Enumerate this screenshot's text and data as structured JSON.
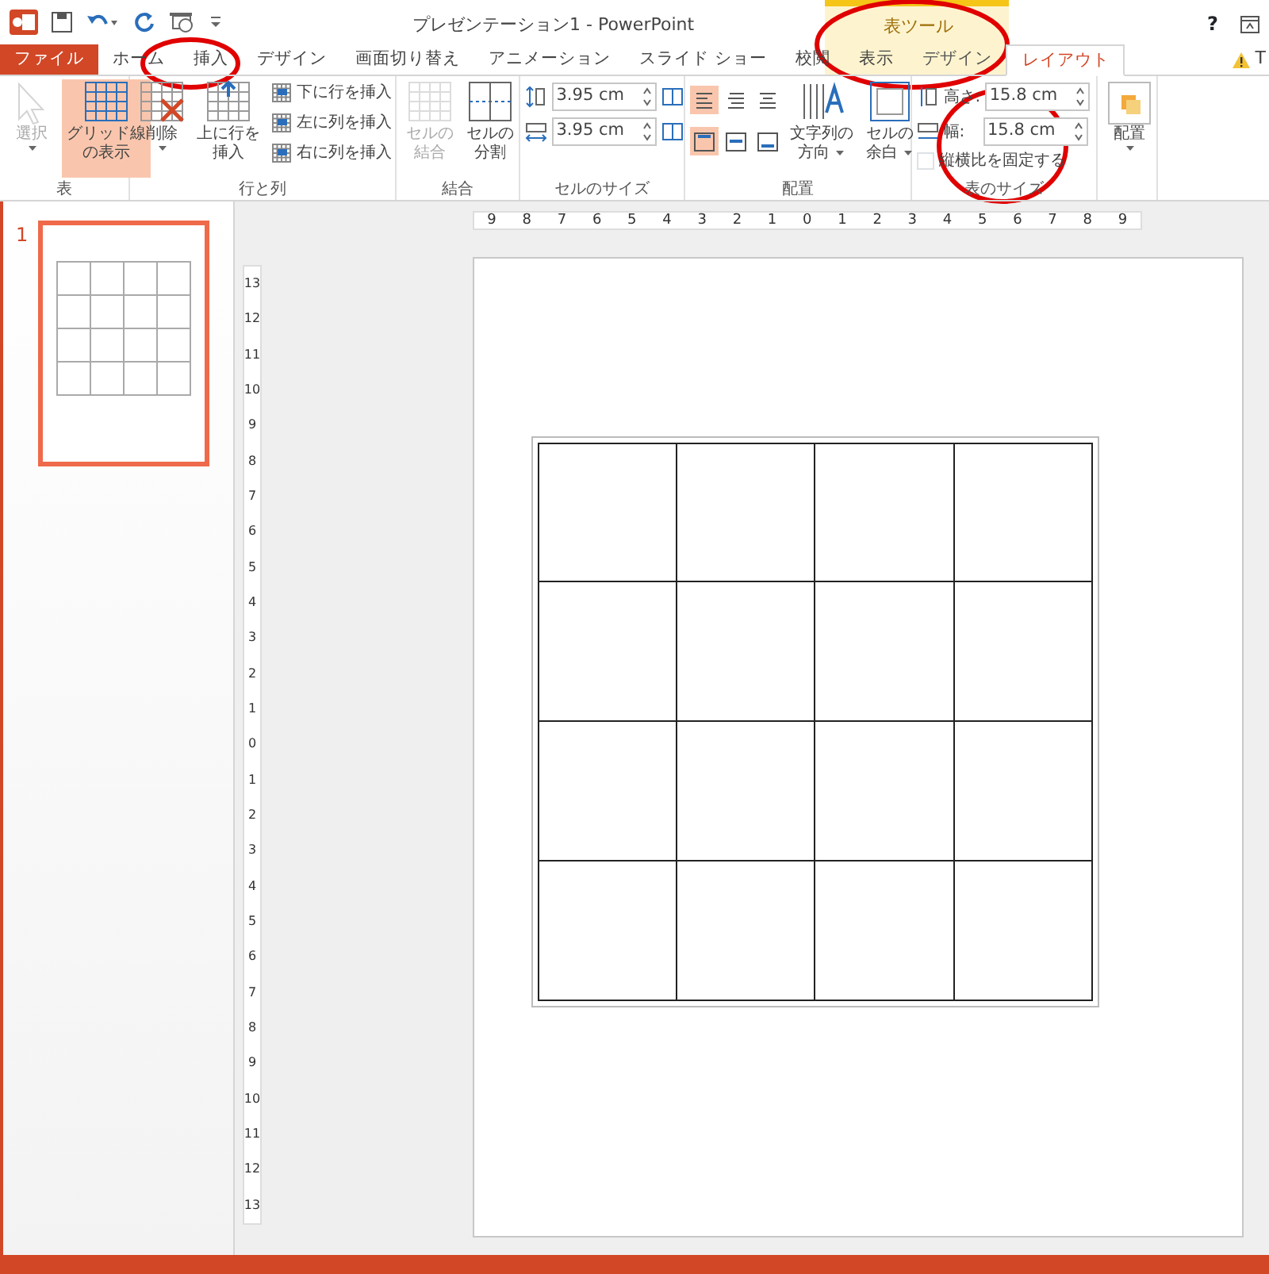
{
  "title_bar": {
    "title": "プレゼンテーション1 - PowerPoint",
    "context_label": "表ツール",
    "help": "?"
  },
  "tabs": [
    {
      "label": "ファイル",
      "kind": "file",
      "selected": false
    },
    {
      "label": "ホーム",
      "kind": "normal",
      "selected": false
    },
    {
      "label": "挿入",
      "kind": "normal",
      "selected": false
    },
    {
      "label": "デザイン",
      "kind": "normal",
      "selected": false
    },
    {
      "label": "画面切り替え",
      "kind": "normal",
      "selected": false
    },
    {
      "label": "アニメーション",
      "kind": "normal",
      "selected": false
    },
    {
      "label": "スライド ショー",
      "kind": "normal",
      "selected": false
    },
    {
      "label": "校閲",
      "kind": "normal",
      "selected": false
    },
    {
      "label": "表示",
      "kind": "normal",
      "selected": false
    },
    {
      "label": "デザイン",
      "kind": "context",
      "selected": false
    },
    {
      "label": "レイアウト",
      "kind": "context",
      "selected": true
    }
  ],
  "account": "T",
  "ribbon": [
    {
      "label": "表",
      "items": [
        {
          "kind": "large",
          "lines": [
            "選択"
          ],
          "disabled": true,
          "dropdown": true,
          "active": false
        },
        {
          "kind": "large",
          "lines": [
            "グリッド線",
            "の表示"
          ],
          "disabled": false,
          "dropdown": false,
          "active": true
        }
      ]
    },
    {
      "label": "行と列",
      "items": [
        {
          "kind": "large",
          "lines": [
            "削除"
          ],
          "disabled": false,
          "dropdown": true,
          "active": false
        },
        {
          "kind": "large",
          "lines": [
            "上に行を",
            "挿入"
          ],
          "disabled": false,
          "dropdown": false,
          "active": false
        },
        {
          "kind": "smalls",
          "entries": [
            "下に行を挿入",
            "左に列を挿入",
            "右に列を挿入"
          ]
        }
      ]
    },
    {
      "label": "結合",
      "items": [
        {
          "kind": "large",
          "lines": [
            "セルの",
            "結合"
          ],
          "disabled": true,
          "dropdown": false,
          "active": false
        },
        {
          "kind": "large",
          "lines": [
            "セルの",
            "分割"
          ],
          "disabled": false,
          "dropdown": false,
          "active": false
        }
      ]
    },
    {
      "label": "セルのサイズ",
      "items": [
        {
          "kind": "spins",
          "fields": [
            {
              "value": "3.95 cm"
            },
            {
              "value": "3.95 cm"
            }
          ]
        }
      ]
    },
    {
      "label": "配置",
      "items": [
        {
          "kind": "aligns",
          "cells": [
            {
              "selected": true
            },
            {
              "selected": false
            },
            {
              "selected": false
            },
            {
              "selected": true
            },
            {
              "selected": false
            },
            {
              "selected": false
            }
          ]
        },
        {
          "kind": "large",
          "lines": [
            "文字列の",
            "方向"
          ],
          "disabled": false,
          "dropdown": true,
          "active": false
        },
        {
          "kind": "large",
          "lines": [
            "セルの",
            "余白"
          ],
          "disabled": false,
          "dropdown": true,
          "active": false
        }
      ]
    },
    {
      "label": "表のサイズ",
      "items": [
        {
          "kind": "sizefields",
          "fields": [
            {
              "label": "高さ:",
              "value": "15.8 cm"
            },
            {
              "label": "幅:",
              "value": "15.8 cm"
            }
          ],
          "checkbox": {
            "label": "縦横比を固定する",
            "checked": false
          }
        }
      ]
    },
    {
      "items": [
        {
          "kind": "large",
          "lines": [
            "配置"
          ],
          "disabled": false,
          "dropdown": true,
          "active": false
        }
      ]
    }
  ],
  "thumbnails": [
    {
      "number": "1",
      "selected": true
    }
  ],
  "horizontal_ruler": [
    "9",
    "8",
    "7",
    "6",
    "5",
    "4",
    "3",
    "2",
    "1",
    "0",
    "1",
    "2",
    "3",
    "4",
    "5",
    "6",
    "7",
    "8",
    "9"
  ],
  "vertical_ruler": [
    "13",
    "12",
    "11",
    "10",
    "9",
    "8",
    "7",
    "6",
    "5",
    "4",
    "3",
    "2",
    "1",
    "0",
    "1",
    "2",
    "3",
    "4",
    "5",
    "6",
    "7",
    "8",
    "9",
    "10",
    "11",
    "12",
    "13"
  ]
}
